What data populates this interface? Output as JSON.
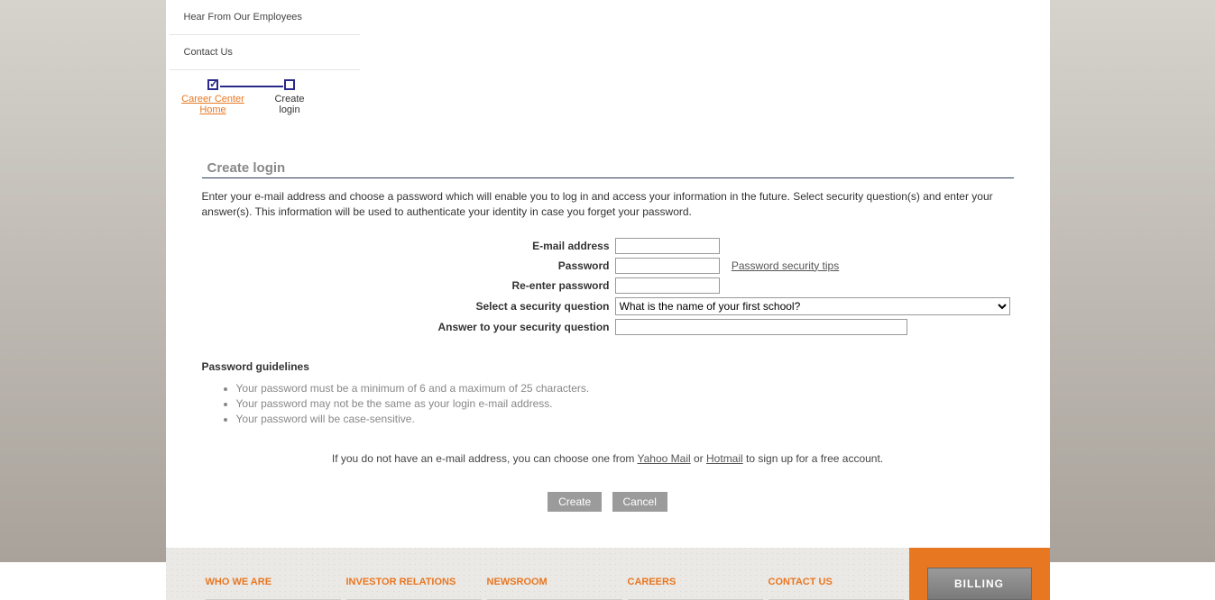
{
  "topnav": {
    "items": [
      "Hear From Our Employees",
      "Contact Us"
    ]
  },
  "wizard": {
    "steps": [
      {
        "label1": "Career Center",
        "label2": "Home"
      },
      {
        "label1": "Create",
        "label2": "login"
      }
    ]
  },
  "section": {
    "title": "Create login",
    "intro": "Enter your e-mail address and choose a password which will enable you to log in and access your information in the future. Select security question(s) and enter your answer(s). This information will be used to authenticate your identity in case you forget your password."
  },
  "form": {
    "email_label": "E-mail address",
    "password_label": "Password",
    "password_tips": "Password security tips",
    "reenter_label": "Re-enter password",
    "question_label": "Select a security question",
    "question_value": "What is the name of your first school?",
    "answer_label": "Answer to your security question"
  },
  "guidelines": {
    "title": "Password guidelines",
    "items": [
      "Your password must be a minimum of 6 and a maximum of 25 characters.",
      "Your password may not be the same as your login e-mail address.",
      "Your password will be case-sensitive."
    ]
  },
  "no_email": {
    "prefix": "If you do not have an e-mail address, you can choose one from ",
    "yahoo": "Yahoo Mail",
    "or": " or ",
    "hotmail": "Hotmail",
    "suffix": " to sign up for a free account."
  },
  "buttons": {
    "create": "Create",
    "cancel": "Cancel"
  },
  "footer": {
    "links": [
      "WHO WE ARE",
      "INVESTOR RELATIONS",
      "NEWSROOM",
      "CAREERS",
      "CONTACT US"
    ],
    "billing": "BILLING"
  }
}
